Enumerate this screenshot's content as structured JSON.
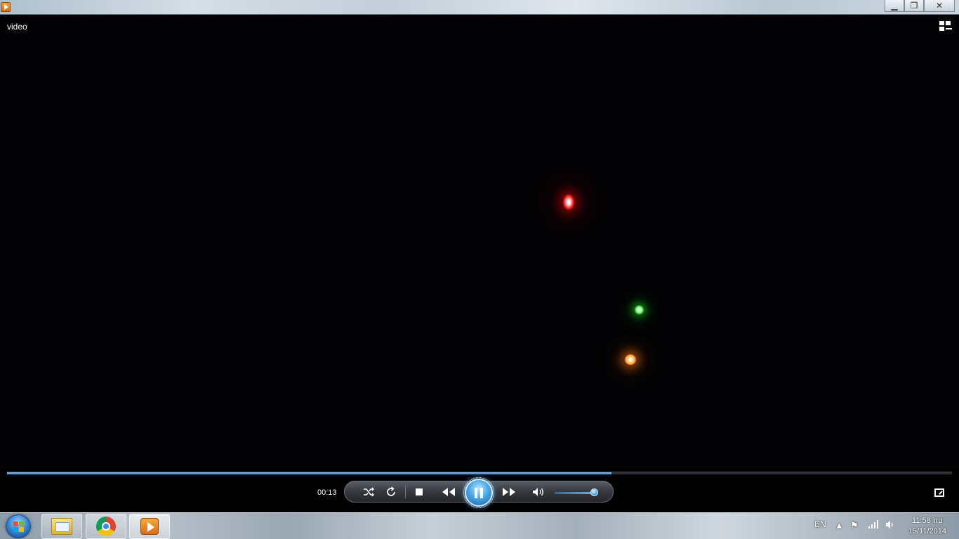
{
  "window": {
    "minimize_glyph": "▁",
    "restore_glyph": "❐",
    "close_glyph": "✕"
  },
  "video": {
    "title": "video"
  },
  "player": {
    "elapsed_time": "00:13",
    "progress_fraction": 0.64,
    "volume_fraction": 0.9,
    "state": "playing",
    "accent_color": "#3a8ad6",
    "icons": [
      "shuffle-icon",
      "repeat-icon",
      "stop-icon",
      "previous-icon",
      "pause-icon",
      "next-icon",
      "volume-icon",
      "fullscreen-icon"
    ]
  },
  "taskbar": {
    "pinned": [
      "windows-explorer",
      "google-chrome",
      "windows-media-player"
    ],
    "language": "EN",
    "time": "11:58 πμ",
    "date": "15/11/2014"
  }
}
